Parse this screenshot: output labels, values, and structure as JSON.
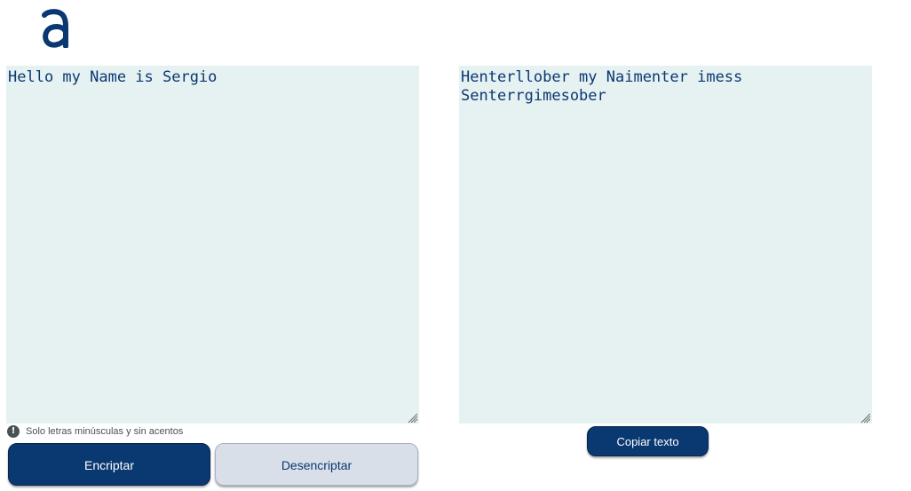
{
  "logo": {
    "icon": "alura-a-logo-icon",
    "color": "#0a3871"
  },
  "input_panel": {
    "text": "Hello my Name is Sergio"
  },
  "output_panel": {
    "text": "Henterllober my Naimenter imess Senterrgimesober"
  },
  "notice": {
    "icon": "exclamation-circle-icon",
    "text": "Solo letras minúsculas y sin acentos"
  },
  "buttons": {
    "encrypt_label": "Encriptar",
    "decrypt_label": "Desencriptar",
    "copy_label": "Copiar texto"
  },
  "colors": {
    "primary": "#0a3871",
    "panel_background": "#e6f1f2",
    "secondary_button": "#d8dfe8"
  }
}
